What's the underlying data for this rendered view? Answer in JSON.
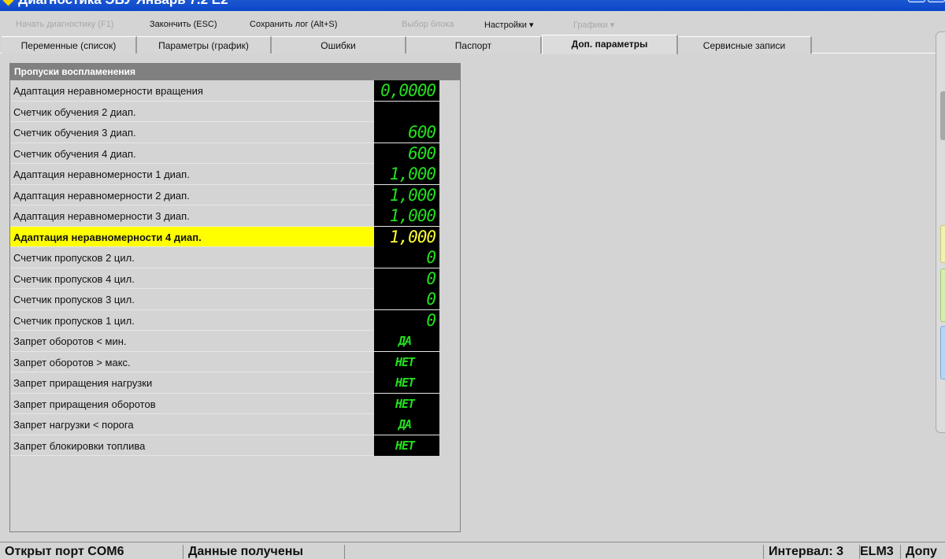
{
  "window": {
    "title": "Диагностика ЭБУ Январь 7.2 E2"
  },
  "toolbar": {
    "start": "Начать диагностику (F1)",
    "stop": "Закончить (ESC)",
    "save_log": "Сохранить лог (Alt+S)",
    "block": "Выбор блока",
    "settings": "Настройки ▾",
    "graphs": "Графики ▾"
  },
  "tabs": [
    "Переменные (список)",
    "Параметры (график)",
    "Ошибки",
    "Паспорт",
    "Доп. параметры",
    "Сервисные записи"
  ],
  "panel": {
    "title": "Пропуски воспламенения",
    "rows": [
      {
        "label": "Адаптация неравномерности вращения",
        "value": "0,0000"
      },
      {
        "label": "Счетчик обучения 2 диап.",
        "value": ""
      },
      {
        "label": "Счетчик обучения 3 диап.",
        "value": "600"
      },
      {
        "label": "Счетчик обучения 4 диап.",
        "value": "600"
      },
      {
        "label": "Адаптация неравномерности 1 диап.",
        "value": "1,000"
      },
      {
        "label": "Адаптация неравномерности 2 диап.",
        "value": "1,000"
      },
      {
        "label": "Адаптация неравномерности 3 диап.",
        "value": "1,000"
      },
      {
        "label": "Адаптация неравномерности 4 диап.",
        "value": "1,000"
      },
      {
        "label": "Счетчик пропусков 2 цил.",
        "value": "0"
      },
      {
        "label": "Счетчик пропусков 4 цил.",
        "value": "0"
      },
      {
        "label": "Счетчик пропусков 3 цил.",
        "value": "0"
      },
      {
        "label": "Счетчик пропусков 1 цил.",
        "value": "0"
      },
      {
        "label": "Запрет оборотов < мин.",
        "value": "ДА"
      },
      {
        "label": "Запрет оборотов > макс.",
        "value": "НЕТ"
      },
      {
        "label": "Запрет приращения нагрузки",
        "value": "НЕТ"
      },
      {
        "label": "Запрет приращения оборотов",
        "value": "НЕТ"
      },
      {
        "label": "Запрет нагрузки < порога",
        "value": "ДА"
      },
      {
        "label": "Запрет блокировки топлива",
        "value": "НЕТ"
      }
    ]
  },
  "status": {
    "port": "Открыт порт COM6",
    "data": "Данные получены",
    "interval": "Интервал: 3",
    "adapter": "ELM3",
    "extra": "Допу"
  }
}
